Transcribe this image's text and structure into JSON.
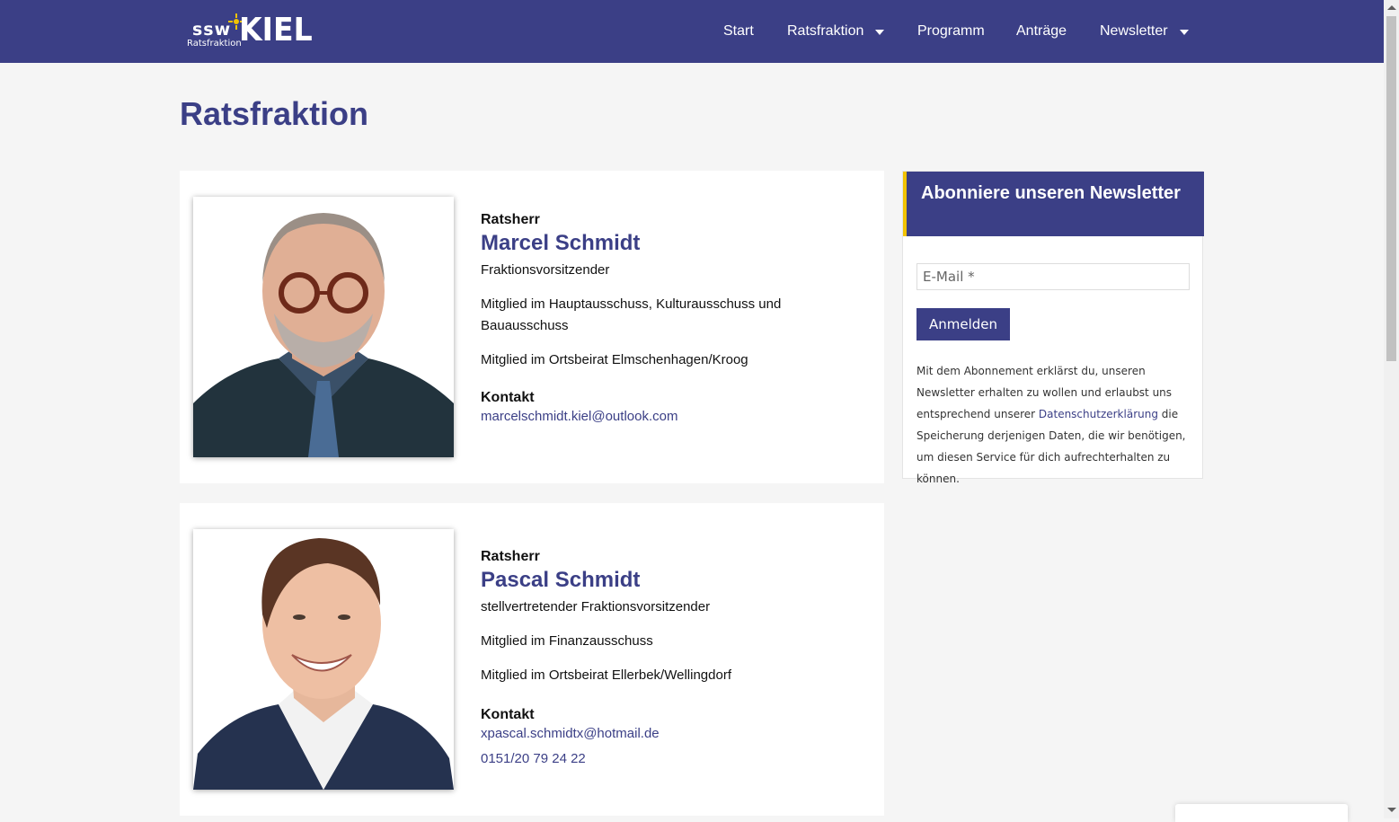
{
  "header": {
    "logo": {
      "brand": "ssw",
      "city": "KIEL",
      "subtitle": "Ratsfraktion"
    },
    "nav": [
      {
        "label": "Start",
        "has_dropdown": false
      },
      {
        "label": "Ratsfraktion",
        "has_dropdown": true
      },
      {
        "label": "Programm",
        "has_dropdown": false
      },
      {
        "label": "Anträge",
        "has_dropdown": false
      },
      {
        "label": "Newsletter",
        "has_dropdown": true
      }
    ]
  },
  "page": {
    "title": "Ratsfraktion"
  },
  "members": [
    {
      "role": "Ratsherr",
      "name": "Marcel Schmidt",
      "lines": [
        "Fraktionsvorsitzender",
        "Mitglied im Hauptausschuss, Kulturausschuss und Bauausschuss",
        "Mitglied im Ortsbeirat Elmschenhagen/Kroog"
      ],
      "contact_heading": "Kontakt",
      "email": "marcelschmidt.kiel@outlook.com",
      "phone": ""
    },
    {
      "role": "Ratsherr",
      "name": "Pascal Schmidt",
      "lines": [
        "stellvertretender Fraktionsvorsitzender",
        "Mitglied im Finanzausschuss",
        "Mitglied im Ortsbeirat Ellerbek/Wellingdorf"
      ],
      "contact_heading": "Kontakt",
      "email": "xpascal.schmidtx@hotmail.de",
      "phone": "0151/20 79 24 22"
    }
  ],
  "newsletter": {
    "title": "Abonniere unseren Newsletter",
    "email_placeholder": "E-Mail *",
    "email_value": "",
    "submit_label": "Anmelden",
    "consent_before": "Mit dem Abonnement erklärst du, unseren Newsletter erhalten zu wollen und erlaubst uns entsprechend unserer ",
    "consent_link": "Datenschutzerklärung",
    "consent_after": " die Speicherung derjenigen Daten, die wir benötigen, um diesen Service für dich aufrechterhalten zu können."
  },
  "colors": {
    "brand": "#3b3f86",
    "accent": "#f2c200",
    "background": "#f5f5f5"
  }
}
